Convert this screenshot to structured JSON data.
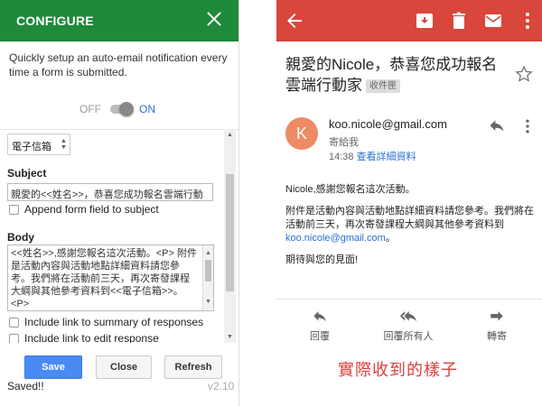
{
  "configure": {
    "title": "CONFIGURE",
    "description": "Quickly setup an auto-email notification every time a form is submitted.",
    "toggle": {
      "off_label": "OFF",
      "on_label": "ON",
      "state": "on"
    },
    "select_value": "電子信箱",
    "subject_label": "Subject",
    "subject_value": "親愛的<<姓名>>，恭喜您成功報名雲端行動",
    "append_label": "Append form field to subject",
    "body_label": "Body",
    "body_value": "<<姓名>>,感謝您報名這次活動。<P> 附件是活動內容與活動地點詳細資料請您參考。我們將在活動前三天，再次寄發課程大綱與其他參考資料到<<電子信箱>>。<P>",
    "summary_label": "Include link to summary of responses",
    "edit_label": "Include link to edit response",
    "buttons": {
      "save": "Save",
      "close": "Close",
      "refresh": "Refresh"
    },
    "status": "Saved!!",
    "version": "v2.10",
    "colors": {
      "header": "#1f8a3a",
      "save": "#4a8af4"
    }
  },
  "gmail": {
    "subject": "親愛的Nicole，恭喜您成功報名雲端行動家",
    "tag": "收件匣",
    "avatar_letter": "K",
    "sender": "koo.nicole@gmail.com",
    "to": "寄給我",
    "time": "14:38",
    "details_link": "查看詳細資料",
    "body": {
      "line1": "Nicole,感謝您報名這次活動。",
      "para2_before": "附件是活動內容與活動地點詳細資料請您參考。我們將在活動前三天，再次寄發課程大綱與其他參考資料到",
      "para2_email": "koo.nicole@gmail.com",
      "para2_after": "。",
      "line3": "期待與您的見面!"
    },
    "actions": {
      "reply": "回覆",
      "reply_all": "回覆所有人",
      "forward": "轉寄"
    },
    "colors": {
      "bar": "#d9463b",
      "avatar": "#ee8a64",
      "link": "#2a6fd6"
    }
  },
  "caption": "實際收到的樣子",
  "icons": [
    "close-icon",
    "back-icon",
    "archive-icon",
    "delete-icon",
    "mail-icon",
    "more-icon",
    "star-icon",
    "reply-icon",
    "reply-all-icon",
    "forward-icon"
  ]
}
